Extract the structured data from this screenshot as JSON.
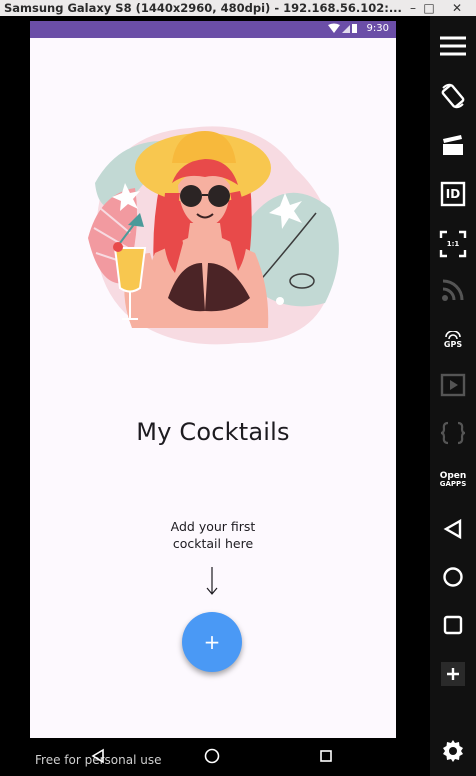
{
  "window": {
    "title": "Samsung Galaxy S8 (1440x2960, 480dpi) - 192.168.56.102:...",
    "minimize": "–",
    "maximize": "□",
    "close": "✕"
  },
  "statusbar": {
    "time": "9:30"
  },
  "app": {
    "title": "My Cocktails",
    "hint_line1": "Add your first",
    "hint_line2": "cocktail here",
    "fab_label": "+"
  },
  "footer": {
    "watermark": "Free for personal use"
  },
  "toolbar": {
    "gps": "GPS",
    "open_line1": "Open",
    "open_line2": "GAPPS",
    "ratio": "1:1",
    "id": "ID"
  },
  "colors": {
    "statusbar": "#6b4ea7",
    "fab": "#4a99f5",
    "screen_bg": "#fdf9fe"
  }
}
